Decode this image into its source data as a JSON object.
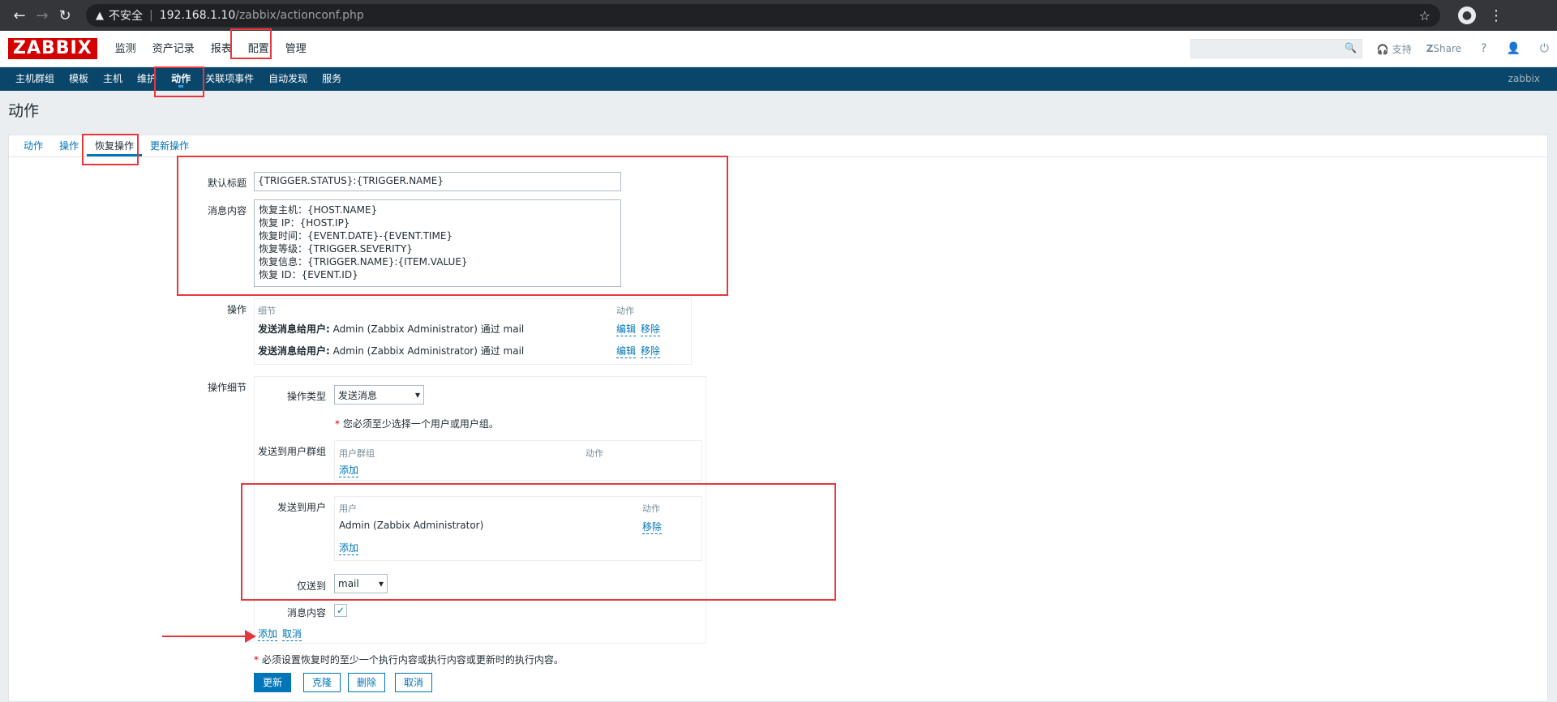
{
  "browser": {
    "security_label": "不安全",
    "url_host": "192.168.1.10",
    "url_path": "/zabbix/actionconf.php"
  },
  "topnav": {
    "logo": "ZABBIX",
    "menu": [
      "监测",
      "资产记录",
      "报表",
      "配置",
      "管理"
    ],
    "support": "支持",
    "share": "Share",
    "help": "?"
  },
  "subnav": {
    "items": [
      "主机群组",
      "模板",
      "主机",
      "维护",
      "动作",
      "关联项事件",
      "自动发现",
      "服务"
    ],
    "server_name": "zabbix"
  },
  "page": {
    "title": "动作",
    "tabs": [
      "动作",
      "操作",
      "恢复操作",
      "更新操作"
    ]
  },
  "form": {
    "default_subject_label": "默认标题",
    "default_subject_value": "{TRIGGER.STATUS}:{TRIGGER.NAME}",
    "message_label": "消息内容",
    "message_value": "恢复主机：{HOST.NAME}\n恢复 IP：{HOST.IP}\n恢复时间：{EVENT.DATE}-{EVENT.TIME}\n恢复等级：{TRIGGER.SEVERITY}\n恢复信息：{TRIGGER.NAME}:{ITEM.VALUE}\n恢复 ID：{EVENT.ID}",
    "operations_label": "操作",
    "operations_table": {
      "col_details": "细节",
      "col_action": "动作",
      "rows": [
        {
          "prefix": "发送消息给用户:",
          "text": " Admin (Zabbix Administrator) 通过 mail",
          "edit": "编辑",
          "remove": "移除"
        },
        {
          "prefix": "发送消息给用户:",
          "text": " Admin (Zabbix Administrator) 通过 mail",
          "edit": "编辑",
          "remove": "移除"
        }
      ]
    },
    "op_details_label": "操作细节",
    "op_type_label": "操作类型",
    "op_type_value": "发送消息",
    "required_hint": "您必须至少选择一个用户或用户组。",
    "user_groups_label": "发送到用户群组",
    "user_groups_col": "用户群组",
    "user_groups_action_col": "动作",
    "user_groups_add": "添加",
    "users_label": "发送到用户",
    "users_col": "用户",
    "users_action_col": "动作",
    "users_row": "Admin (Zabbix Administrator)",
    "users_remove": "移除",
    "users_add": "添加",
    "send_only_label": "仅送到",
    "send_only_value": "mail",
    "msg_content_label": "消息内容",
    "add_link": "添加",
    "cancel_link": "取消",
    "footer_hint": "必须设置恢复时的至少一个执行内容或执行内容或更新时的执行内容。"
  },
  "buttons": {
    "update": "更新",
    "clone": "克隆",
    "delete": "删除",
    "cancel": "取消"
  },
  "colors": {
    "annotation": "#e8373c",
    "primary": "#0275b8",
    "navbar": "#0a466a"
  }
}
